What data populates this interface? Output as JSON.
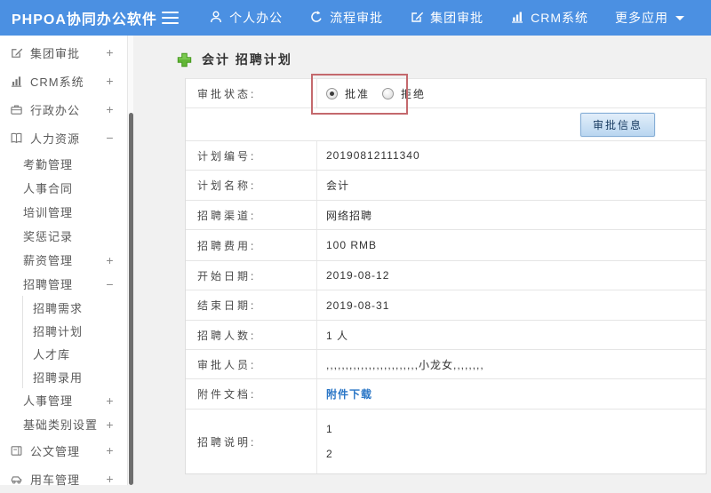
{
  "app": {
    "title": "PHPOA协同办公软件"
  },
  "topnav": {
    "items": [
      {
        "label": "个人办公",
        "icon": "person-icon"
      },
      {
        "label": "流程审批",
        "icon": "process-arrow-icon"
      },
      {
        "label": "集团审批",
        "icon": "edit-icon"
      },
      {
        "label": "CRM系统",
        "icon": "bar-chart-icon"
      },
      {
        "label": "更多应用",
        "icon": "caret-down-icon"
      }
    ]
  },
  "sidebar": {
    "items": [
      {
        "label": "集团审批",
        "toggle": "+",
        "icon": "edit-icon"
      },
      {
        "label": "CRM系统",
        "toggle": "+",
        "icon": "bar-chart-icon"
      },
      {
        "label": "行政办公",
        "toggle": "+",
        "icon": "briefcase-icon"
      },
      {
        "label": "人力资源",
        "toggle": "−",
        "icon": "book-icon"
      },
      {
        "label": "考勤管理",
        "toggle": ""
      },
      {
        "label": "人事合同",
        "toggle": ""
      },
      {
        "label": "培训管理",
        "toggle": ""
      },
      {
        "label": "奖惩记录",
        "toggle": ""
      },
      {
        "label": "薪资管理",
        "toggle": "+"
      },
      {
        "label": "招聘管理",
        "toggle": "−"
      },
      {
        "label": "招聘需求",
        "toggle": ""
      },
      {
        "label": "招聘计划",
        "toggle": ""
      },
      {
        "label": "人才库",
        "toggle": ""
      },
      {
        "label": "招聘录用",
        "toggle": ""
      },
      {
        "label": "人事管理",
        "toggle": "+"
      },
      {
        "label": "基础类别设置",
        "toggle": "+"
      },
      {
        "label": "公文管理",
        "toggle": "+",
        "icon": "document-icon"
      },
      {
        "label": "用车管理",
        "toggle": "+",
        "icon": "car-icon"
      }
    ]
  },
  "main": {
    "page_title": "会计 招聘计划",
    "approval": {
      "status_label": "审批状态:",
      "approve_label": "批准",
      "approve_checked": true,
      "reject_label": "拒绝",
      "reject_checked": false,
      "info_button": "审批信息"
    },
    "fields": [
      {
        "label": "计划编号:",
        "value": "20190812111340"
      },
      {
        "label": "计划名称:",
        "value": "会计"
      },
      {
        "label": "招聘渠道:",
        "value": "网络招聘"
      },
      {
        "label": "招聘费用:",
        "value": "100 RMB"
      },
      {
        "label": "开始日期:",
        "value": "2019-08-12"
      },
      {
        "label": "结束日期:",
        "value": "2019-08-31"
      },
      {
        "label": "招聘人数:",
        "value": "1 人"
      },
      {
        "label": "审批人员:",
        "value": ",,,,,,,,,,,,,,,,,,,,,,,,小龙女,,,,,,,,"
      },
      {
        "label": "附件文档:",
        "value": "附件下载",
        "type": "link"
      },
      {
        "label": "招聘说明:",
        "lines": [
          "1",
          "2"
        ]
      }
    ]
  },
  "colors": {
    "topbar_blue": "#4b90e2",
    "annotation_red": "#c4696d",
    "link_blue": "#2a76c6",
    "plus_green": "#62b636",
    "button_border": "#86aed6",
    "button_bg_top": "#e2eefa",
    "button_bg_bottom": "#b9d6f0"
  }
}
